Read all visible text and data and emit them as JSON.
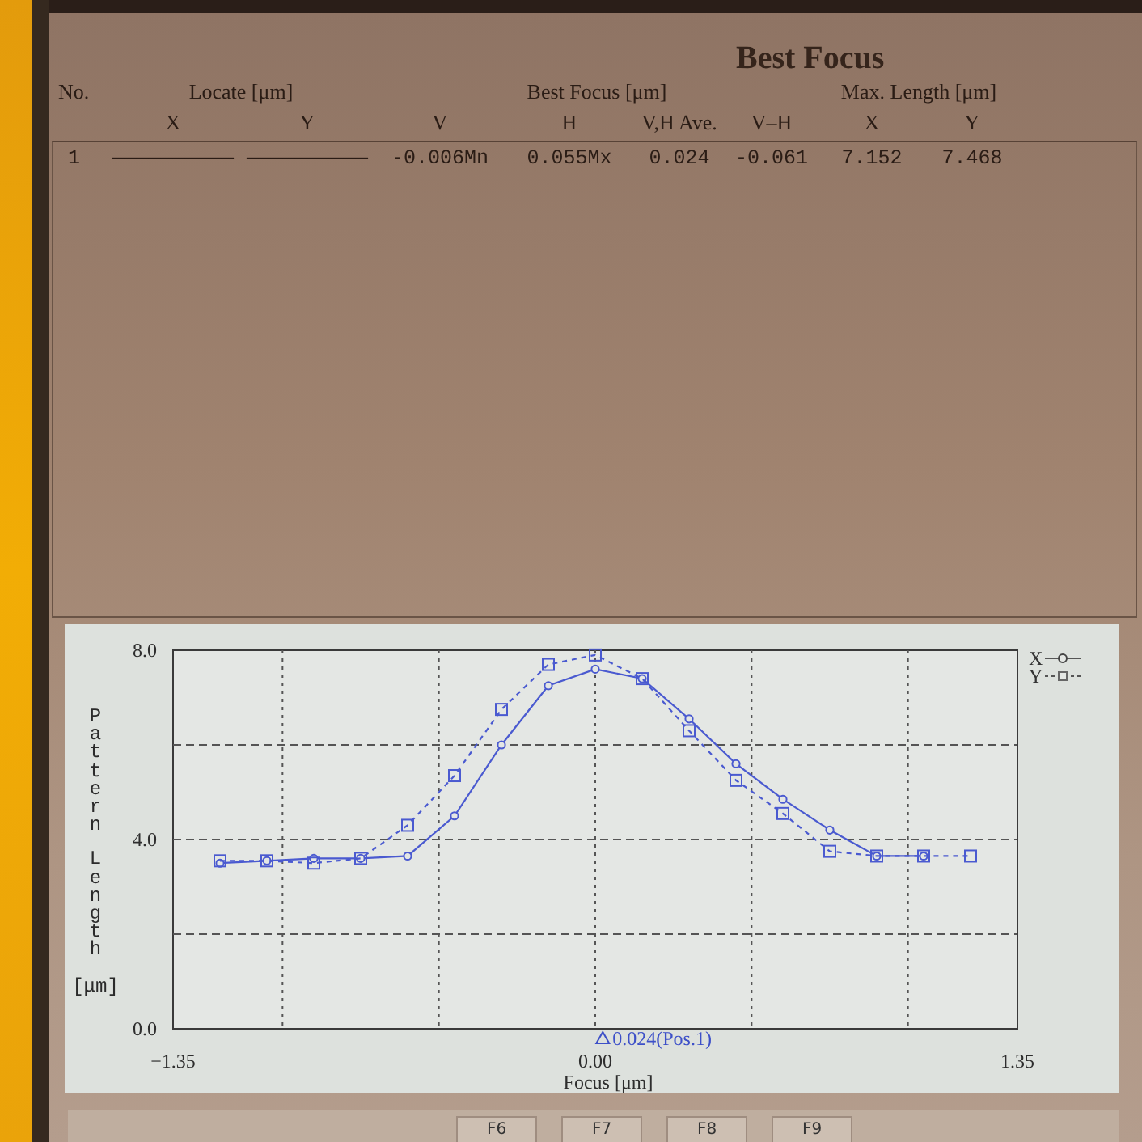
{
  "window": {
    "title": "Best Focus"
  },
  "table": {
    "column_groups": [
      {
        "label": "No."
      },
      {
        "label": "Locate [μm]",
        "columns": [
          "X",
          "Y"
        ]
      },
      {
        "label": "Best Focus [μm]",
        "columns": [
          "V",
          "H",
          "V,H Ave.",
          "V–H"
        ]
      },
      {
        "label": "Max. Length [μm]",
        "columns": [
          "X",
          "Y"
        ]
      }
    ],
    "rows": [
      {
        "cells": [
          "1",
          "——————————",
          "——————————",
          "-0.006Mn",
          "0.055Mx",
          "0.024",
          "-0.061",
          "7.152",
          "7.468"
        ]
      }
    ]
  },
  "chart": {
    "chart_data": {
      "type": "line",
      "xlabel": "Focus [μm]",
      "ylabel": "Pattern Length [μm]",
      "x": [
        -1.2,
        -1.05,
        -0.9,
        -0.75,
        -0.6,
        -0.45,
        -0.3,
        -0.15,
        0,
        0.15,
        0.3,
        0.45,
        0.6,
        0.75,
        0.9,
        1.05,
        1.2
      ],
      "series": [
        {
          "name": "X",
          "color": "#4a5ad0",
          "line_style": "solid",
          "marker": "circle",
          "values": [
            3.5,
            3.55,
            3.6,
            3.6,
            3.65,
            4.5,
            6.0,
            7.25,
            7.6,
            7.4,
            6.55,
            5.6,
            4.85,
            4.2,
            3.65,
            3.65,
            null
          ]
        },
        {
          "name": "Y",
          "color": "#4a5ad0",
          "line_style": "dashed",
          "marker": "square",
          "values": [
            3.55,
            3.55,
            3.5,
            3.6,
            4.3,
            5.35,
            6.75,
            7.7,
            7.9,
            7.4,
            6.3,
            5.25,
            4.55,
            3.75,
            3.65,
            3.65,
            3.65
          ]
        }
      ],
      "xlim": [
        -1.35,
        1.35
      ],
      "ylim": [
        0,
        8
      ],
      "xticks": [
        {
          "value": -1.35,
          "label": "−1.35"
        },
        {
          "value": 0,
          "label": "0.00"
        },
        {
          "value": 1.35,
          "label": "1.35"
        }
      ],
      "yticks": [
        {
          "value": 0,
          "label": "0.0"
        },
        {
          "value": 4,
          "label": "4.0"
        },
        {
          "value": 8,
          "label": "8.0"
        }
      ],
      "annotations": [
        {
          "x": 0.024,
          "text": "0.024(Pos.1)"
        }
      ]
    }
  },
  "function_keys": [
    "F6",
    "F7",
    "F8",
    "F9"
  ]
}
